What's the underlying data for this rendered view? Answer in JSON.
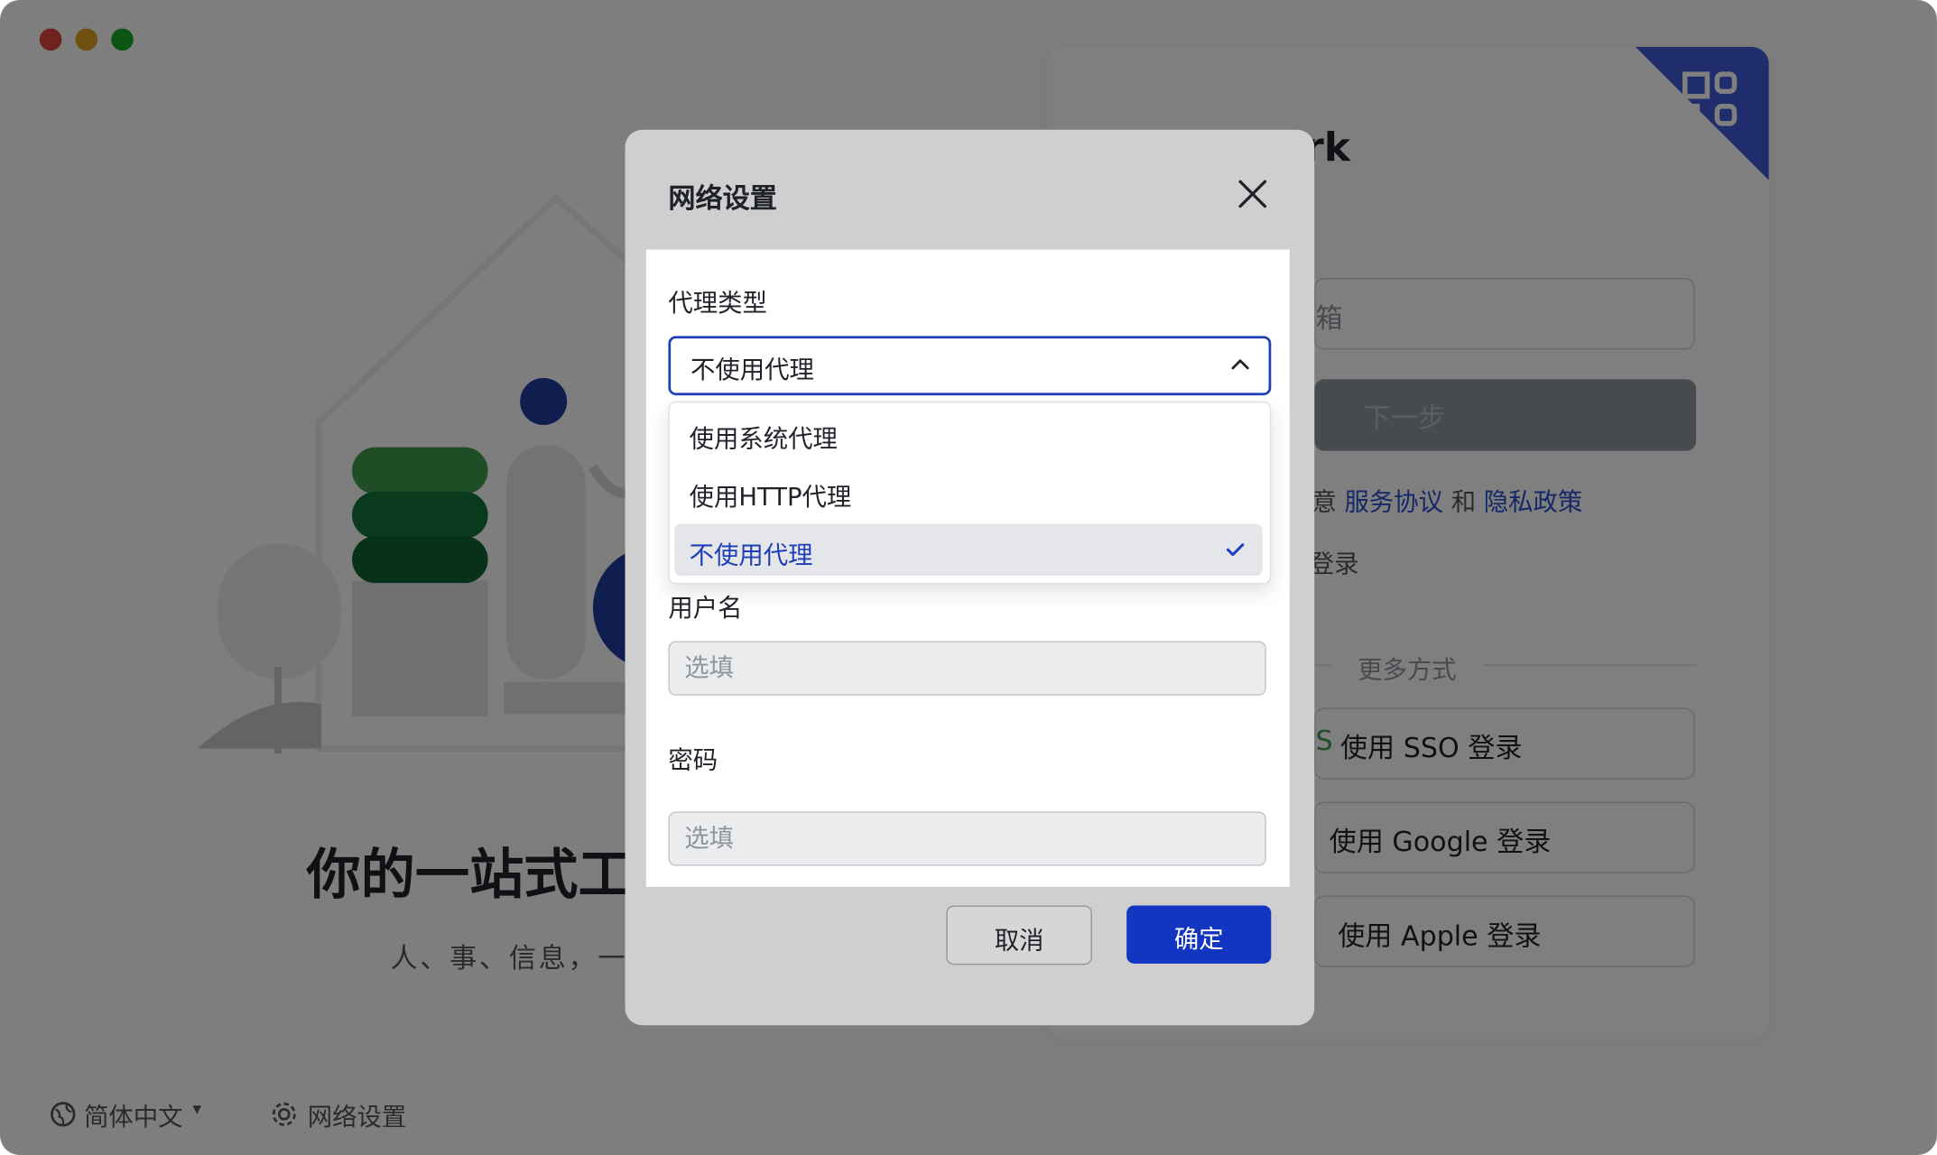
{
  "window": {
    "traffic_lights": {
      "close": "#e0443e",
      "minimize": "#dea123",
      "zoom": "#1aab29"
    }
  },
  "background": {
    "hero_title": "你的一站式工",
    "hero_subtitle": "人、事、信息，一",
    "login_title_fragment": "rk",
    "email_placeholder_fragment": "箱",
    "next_button": "下一步",
    "agreement": {
      "prefix": "意 ",
      "terms": "服务协议",
      "and": " 和 ",
      "privacy": "隐私政策"
    },
    "login_fragment": "登录",
    "more_methods": "更多方式",
    "sso_button": "使用 SSO 登录",
    "google_button": "使用 Google 登录",
    "apple_button": "使用 Apple 登录",
    "footer": {
      "language": "简体中文",
      "network_settings": "网络设置"
    }
  },
  "dialog": {
    "title": "网络设置",
    "proxy_type_label": "代理类型",
    "proxy_type_value": "不使用代理",
    "options": [
      "使用系统代理",
      "使用HTTP代理",
      "不使用代理"
    ],
    "selected_index": 2,
    "username_label": "用户名",
    "username_placeholder": "选填",
    "password_label": "密码",
    "password_placeholder": "选填",
    "cancel_label": "取消",
    "confirm_label": "确定"
  },
  "colors": {
    "accent": "#1235c2",
    "link": "#2a4fd0",
    "illustration_green": "#15753a",
    "illustration_blue": "#1f3a9e"
  }
}
